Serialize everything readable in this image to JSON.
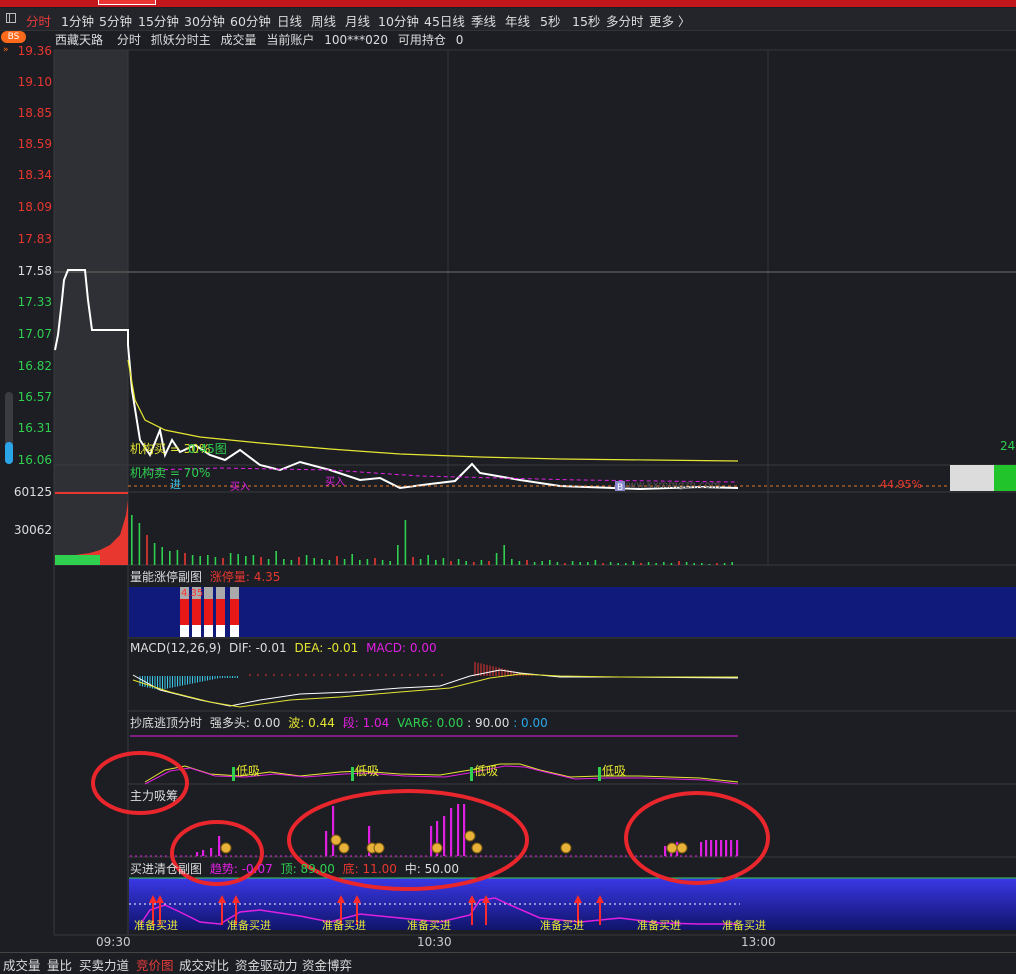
{
  "periods": [
    "分时",
    "1分钟",
    "5分钟",
    "15分钟",
    "30分钟",
    "60分钟",
    "日线",
    "周线",
    "月线",
    "10分钟",
    "45日线",
    "季线",
    "年线",
    "5秒",
    "15秒",
    "多分时",
    "更多 〉"
  ],
  "active_period": "分时",
  "badge": "BS",
  "header": {
    "name": "西藏天路",
    "items": [
      "分时",
      "抓妖分时主",
      "成交量",
      "当前账户",
      "100***020",
      "可用持仓",
      "0"
    ]
  },
  "price_axis": {
    "red": [
      "19.36",
      "19.10",
      "18.85",
      "18.59",
      "18.34",
      "18.09",
      "17.83"
    ],
    "white": "17.58",
    "green": [
      "17.33",
      "17.07",
      "16.82",
      "16.57",
      "16.31",
      "16.06"
    ]
  },
  "volume_axis": [
    "60125",
    "30062"
  ],
  "chart_labels": {
    "inst_buy": "机构买 = 30%",
    "inst_buy_overlay": "0.45图",
    "inst_sell": "机构卖 = 70%",
    "count_right": "24",
    "pct_right": "44.95%",
    "watermark": "www.kxmmgzh.com",
    "mark_b": "B",
    "mark_in": "进",
    "mark_buy": "买入",
    "mark_buy2": "买入"
  },
  "panels": {
    "limit": {
      "title": "量能涨停副图",
      "label": "涨停量:",
      "value": "4.35",
      "overlay": "4.35"
    },
    "macd": {
      "title": "MACD(12,26,9)",
      "dif_label": "DIF:",
      "dif": "-0.01",
      "dea_label": "DEA:",
      "dea": "-0.01",
      "macd_label": "MACD:",
      "macd": "0.00"
    },
    "bottom_top": {
      "title": "抄底逃顶分时",
      "strong_label": "强多头:",
      "strong": "0.00",
      "wave_label": "波:",
      "wave": "0.44",
      "seg_label": "段:",
      "seg": "1.04",
      "var6_label": "VAR6:",
      "var6": "0.00",
      "v90": ": 90.00",
      "vblue": ": 0.00",
      "low_suck": "低吸"
    },
    "main": {
      "title": "主力吸筹"
    },
    "clear": {
      "title": "买进清仓副图",
      "trend_label": "趋势:",
      "trend": "-0.07",
      "top_label": "顶:",
      "top": "89.00",
      "bot_label": "底:",
      "bot": "11.00",
      "mid_label": "中:",
      "mid": "50.00",
      "prepare": "准备买进",
      "buy": "买"
    }
  },
  "time_axis": [
    "09:30",
    "10:30",
    "13:00"
  ],
  "bottom_tabs": [
    "成交量",
    "量比",
    "买卖力道",
    "竞价图",
    "成交对比",
    "资金驱动力",
    "资金博弈"
  ],
  "active_bottom_tab": "竞价图",
  "colors": {
    "up": "#e8372f",
    "down": "#2fcf4f",
    "accent": "#e63b3b",
    "magenta": "#e020e0",
    "yellow": "#e6e632",
    "price": "#ffffff"
  }
}
